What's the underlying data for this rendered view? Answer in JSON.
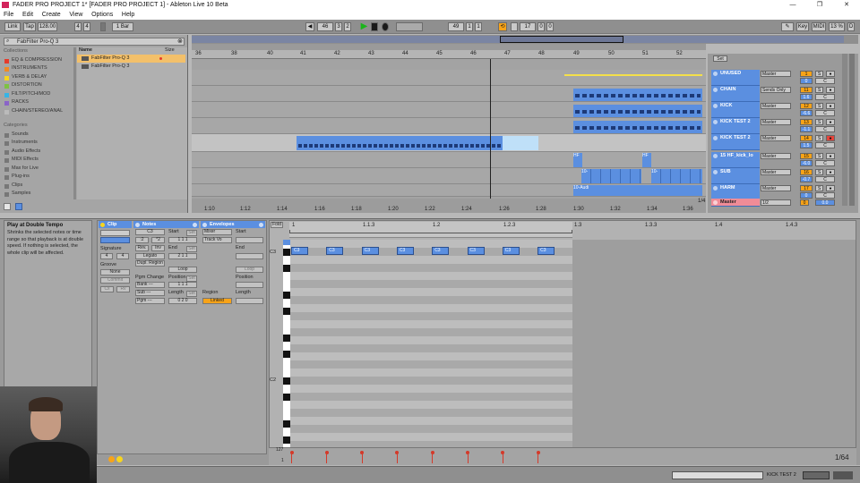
{
  "window": {
    "title": "FADER PRO PROJECT 1* [FADER PRO PROJECT 1] - Ableton Live 10 Beta",
    "minimize": "—",
    "maximize": "❐",
    "close": "✕"
  },
  "menu": [
    "File",
    "Edit",
    "Create",
    "View",
    "Options",
    "Help"
  ],
  "transport": {
    "link": "Link",
    "tap": "Tap",
    "tempo": "128.00",
    "sig_num": "4",
    "sig_den": "4",
    "quantize": "1 Bar",
    "pos_bar": "46",
    "pos_beat": "3",
    "pos_sixteenth": "2",
    "loop_bar": "49",
    "loop_beat": "1",
    "loop_sixteenth": "1",
    "loop_len_bar": "17",
    "loop_len_beat": "0",
    "loop_len_sixteenth": "0",
    "key": "Key",
    "midi": "MIDI",
    "cpu": "13 %",
    "cpu_d": "D"
  },
  "browser": {
    "search_value": "FabFilter Pro-Q 3",
    "collections_header": "Collections",
    "collections": [
      {
        "label": "EQ & COMPRESSION",
        "color": "#e63a2a"
      },
      {
        "label": "INSTRUMENTS",
        "color": "#f08a24"
      },
      {
        "label": "VERB & DELAY",
        "color": "#f7d51e"
      },
      {
        "label": "DISTORTION",
        "color": "#7dc242"
      },
      {
        "label": "FILT/PITCH/MOD",
        "color": "#36b4e5"
      },
      {
        "label": "RACKS",
        "color": "#8a64c8"
      },
      {
        "label": "CHAIN/STEREO/ANAL",
        "color": "#bbbbbb"
      }
    ],
    "categories_header": "Categories",
    "categories": [
      "Sounds",
      "Instruments",
      "Audio Effects",
      "MIDI Effects",
      "Max for Live",
      "Plug-ins",
      "Clips",
      "Samples"
    ],
    "name_header": "Name",
    "size_header": "Size",
    "results": [
      "FabFilter Pro-Q 3",
      "FabFilter Pro-Q 3"
    ]
  },
  "arrangement": {
    "ruler_marks": [
      "36",
      "38",
      "40",
      "41",
      "42",
      "43",
      "44",
      "45",
      "46",
      "47",
      "48",
      "49",
      "50",
      "51",
      "52"
    ],
    "time_marks": [
      "1:10",
      "1:12",
      "1:14",
      "1:16",
      "1:18",
      "1:20",
      "1:22",
      "1:24",
      "1:26",
      "1:28",
      "1:30",
      "1:32",
      "1:34",
      "1:36"
    ],
    "zoom": "1/4",
    "set_label": "Set"
  },
  "tracks": [
    {
      "name": "UNUSED",
      "route": "Master",
      "num": "1",
      "vol": "0",
      "pan": "C"
    },
    {
      "name": "CHAIN",
      "route": "Sends Only",
      "num": "11",
      "vol": "1.6",
      "pan": "C"
    },
    {
      "name": "KICK",
      "route": "Master",
      "num": "12",
      "vol": "-6.6",
      "pan": "C"
    },
    {
      "name": "KICK TEST 2",
      "route": "Master",
      "num": "13",
      "vol": "-1.1",
      "pan": "C"
    },
    {
      "name": "KICK TEST 2",
      "route": "Master",
      "num": "14",
      "vol": "1.5",
      "pan": "C"
    },
    {
      "name": "15 HF_kick_lo",
      "route": "Master",
      "num": "15",
      "vol": "-6.0",
      "pan": "C"
    },
    {
      "name": "SUB",
      "route": "Master",
      "num": "16",
      "vol": "-0.7",
      "pan": "C"
    },
    {
      "name": "HARM",
      "route": "Master",
      "num": "17",
      "vol": "0",
      "pan": "C"
    }
  ],
  "master": {
    "name": "Master",
    "route": "1/2",
    "vol": "0",
    "pan": "0.0"
  },
  "clip_labels": {
    "hf": "HF",
    "ten": "10-",
    "aud": "10-Audi"
  },
  "info": {
    "title": "Play at Double Tempo",
    "text": "Shrinks the selected notes or time range so that playback is at double speed. If nothing is selected, the whole clip will be affected."
  },
  "clip": {
    "header": "Clip",
    "notes_header": "Notes",
    "envelopes_header": "Envelopes",
    "signature": "Signature",
    "sig_num": "4",
    "sig_den": "4",
    "groove": "Groove",
    "groove_value": "None",
    "commit": "Commit",
    "pitch": "C3",
    "start": "Start",
    "end": "End",
    "set": "Set",
    "div2": ":2",
    "mul2": "*2",
    "rev": "Rev.",
    "inv": "Inv",
    "legato": "Legato",
    "dupl": "Dupl. Region",
    "loop": "Loop",
    "position": "Position",
    "length": "Length",
    "pgm_change": "Pgm Change",
    "bank": "Bank ---",
    "sub": "Sub ---",
    "pgm": "Pgm ---",
    "mixer": "Mixer",
    "track_vol": "Track Vo",
    "region": "Region",
    "linked": "Linked",
    "start_val": "1  1  1",
    "end_val": "2  1  1",
    "len_val": "0  2  0",
    "cxl": "Cx",
    "rev2": "Rv"
  },
  "midi_editor": {
    "fold": "Fold",
    "bar_marks": [
      "1",
      "1.1.3",
      "1.2",
      "1.2.3",
      "1.3",
      "1.3.3",
      "1.4",
      "1.4.3"
    ],
    "note_label": "C3",
    "notes_count": 8,
    "c3": "C3",
    "c2": "C2",
    "vel_top": "127",
    "vel_bottom": "1",
    "zoom": "1/64"
  },
  "status": {
    "track": "KICK TEST 2",
    "device": "▭"
  }
}
